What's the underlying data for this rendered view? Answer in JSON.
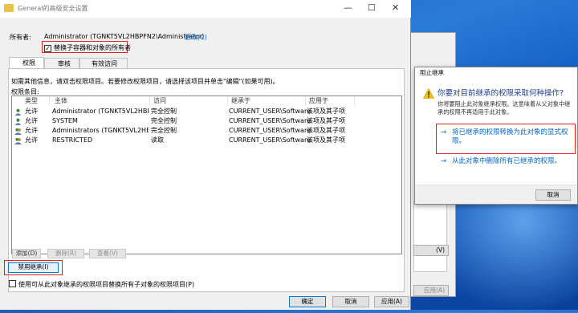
{
  "colors": {
    "accent_red": "#e0231f",
    "link_blue": "#0066cc"
  },
  "window": {
    "title": "General的高级安全设置",
    "controls": {
      "minimize": "—",
      "maximize": "☐",
      "close": "✕"
    },
    "owner_label": "所有者:",
    "owner_value": "Administrator (TGNKT5VL2HBPFN2\\Administrator)",
    "owner_change": "更改(C)",
    "replace_owner_checkbox": "替换子容器和对象的所有者",
    "tabs": [
      "权限",
      "审核",
      "有效访问"
    ],
    "info_text": "如需其他信息，请双击权限项目。若要修改权限项目，请选择该项目并单击\"编辑\"(如果可用)。",
    "entries_label": "权限条目:",
    "columns": [
      "类型",
      "主体",
      "访问",
      "继承于",
      "应用于"
    ],
    "rows": [
      {
        "type": "允许",
        "principal": "Administrator (TGNKT5VL2HBPF...",
        "access": "完全控制",
        "inherited": "CURRENT_USER\\Software",
        "applies": "该项及其子项"
      },
      {
        "type": "允许",
        "principal": "SYSTEM",
        "access": "完全控制",
        "inherited": "CURRENT_USER\\Software",
        "applies": "该项及其子项"
      },
      {
        "type": "允许",
        "principal": "Administrators (TGNKT5VL2HBP...",
        "access": "完全控制",
        "inherited": "CURRENT_USER\\Software",
        "applies": "该项及其子项"
      },
      {
        "type": "允许",
        "principal": "RESTRICTED",
        "access": "读取",
        "inherited": "CURRENT_USER\\Software",
        "applies": "该项及其子项"
      }
    ],
    "buttons": {
      "add": "添加(D)",
      "remove": "删除(R)",
      "view": "查看(V)",
      "disable_inherit": "禁用继承(I)",
      "replace_all_checkbox": "使用可从此对象继承的权限项目替换所有子对象的权限项目(P)",
      "ok": "确定",
      "cancel": "取消",
      "apply": "应用(A)"
    }
  },
  "back_window": {
    "view_btn": "(V)",
    "apply_btn": "应用(A)"
  },
  "dialog": {
    "title": "阻止继承",
    "question": "你要对目前继承的权限采取何种操作?",
    "desc": "你将要阻止此对象继承权限。这意味着从父对象中继承的权限不再适用于此对象。",
    "option1": "将已继承的权限转换为此对象的显式权限。",
    "option2": "从此对象中删除所有已继承的权限。",
    "cancel": "取消"
  }
}
